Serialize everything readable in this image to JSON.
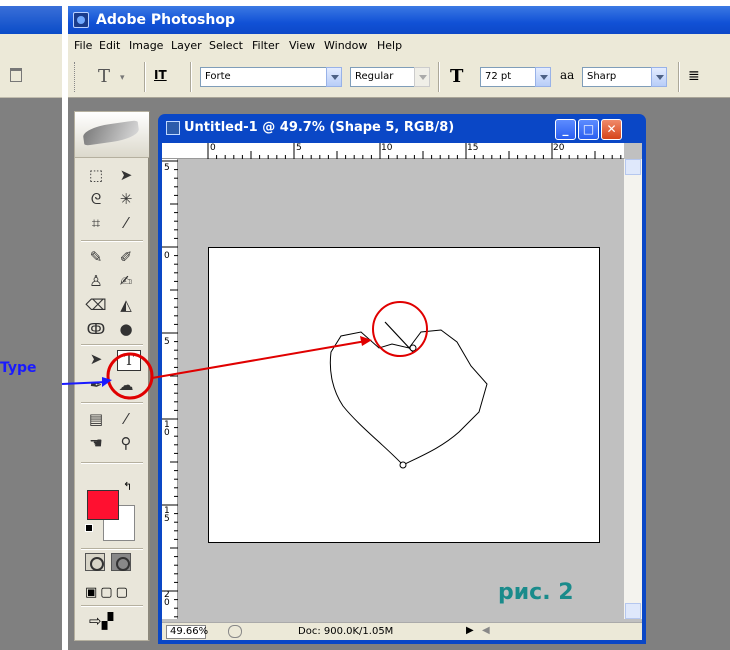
{
  "app": {
    "title": "Adobe Photoshop"
  },
  "menu": [
    "File",
    "Edit",
    "Image",
    "Layer",
    "Select",
    "Filter",
    "View",
    "Window",
    "Help"
  ],
  "options_bar": {
    "tool_glyph": "T",
    "orient_glyph": "IT",
    "font_family": "Forte",
    "font_style": "Regular",
    "size_glyph": "T",
    "font_size": "72 pt",
    "aa_glyph": "aa",
    "antialias": "Sharp"
  },
  "document": {
    "title": "Untitled-1 @ 49.7% (Shape 5, RGB/8)",
    "ruler_top": [
      "0",
      "5",
      "10",
      "15",
      "20"
    ],
    "ruler_left": [
      "5",
      "0",
      "5",
      "10",
      "15",
      "20"
    ],
    "status_zoom": "49.66%",
    "status_doc": "Doc: 900.0K/1.05M"
  },
  "annotations": {
    "type_label": "Type",
    "figure_label": "рис. 2"
  },
  "colors": {
    "foreground": "#ff1030",
    "background": "#ffffff",
    "highlight": "#e00000",
    "label_type": "#1a1aff",
    "label_figure": "#1a8b8b"
  },
  "icons": [
    "marquee-icon",
    "move-icon",
    "lasso-icon",
    "magic-wand-icon",
    "crop-icon",
    "slice-icon",
    "healing-icon",
    "brush-icon",
    "stamp-icon",
    "history-brush-icon",
    "eraser-icon",
    "bucket-icon",
    "blur-icon",
    "dodge-icon",
    "path-select-icon",
    "type-icon",
    "pen-icon",
    "shape-icon",
    "notes-icon",
    "eyedropper-icon",
    "hand-icon",
    "zoom-icon"
  ]
}
